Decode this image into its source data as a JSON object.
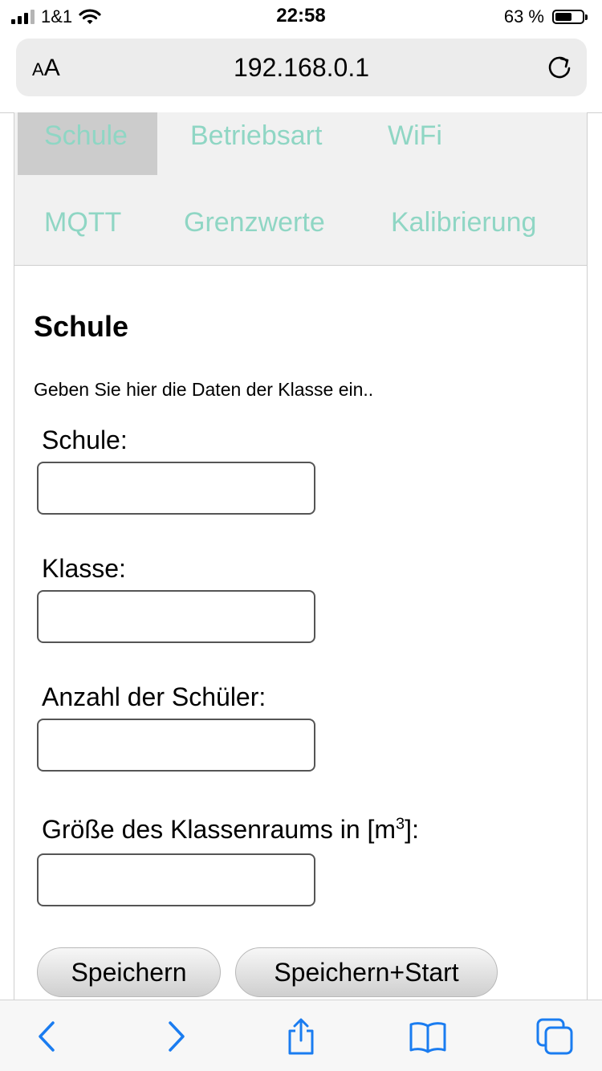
{
  "status_bar": {
    "carrier": "1&1",
    "time": "22:58",
    "battery_percent": "63 %",
    "battery_level": 0.63
  },
  "address_bar": {
    "text_size_label_small": "A",
    "text_size_label_large": "A",
    "url": "192.168.0.1"
  },
  "tabs": [
    {
      "label": "Schule",
      "active": true
    },
    {
      "label": "Betriebsart",
      "active": false
    },
    {
      "label": "WiFi",
      "active": false
    },
    {
      "label": "MQTT",
      "active": false
    },
    {
      "label": "Grenzwerte",
      "active": false
    },
    {
      "label": "Kalibrierung",
      "active": false
    }
  ],
  "section": {
    "title": "Schule",
    "intro": "Geben Sie hier die Daten der Klasse ein.."
  },
  "form": {
    "fields": [
      {
        "label": "Schule:",
        "value": ""
      },
      {
        "label": "Klasse:",
        "value": ""
      },
      {
        "label": "Anzahl der Schüler:",
        "value": ""
      },
      {
        "label": "Größe des Klassenraums in [m",
        "label_sup": "3",
        "label_suffix": "]:",
        "value": ""
      }
    ],
    "buttons": {
      "save": "Speichern",
      "save_start": "Speichern+Start"
    }
  },
  "colors": {
    "tab_text": "#8fd6c4",
    "tab_active_bg": "#cccccc",
    "toolbar_icon": "#1a7cf0"
  },
  "toolbar": {
    "icons": [
      "back-icon",
      "forward-icon",
      "share-icon",
      "bookmarks-icon",
      "tabs-icon"
    ]
  }
}
